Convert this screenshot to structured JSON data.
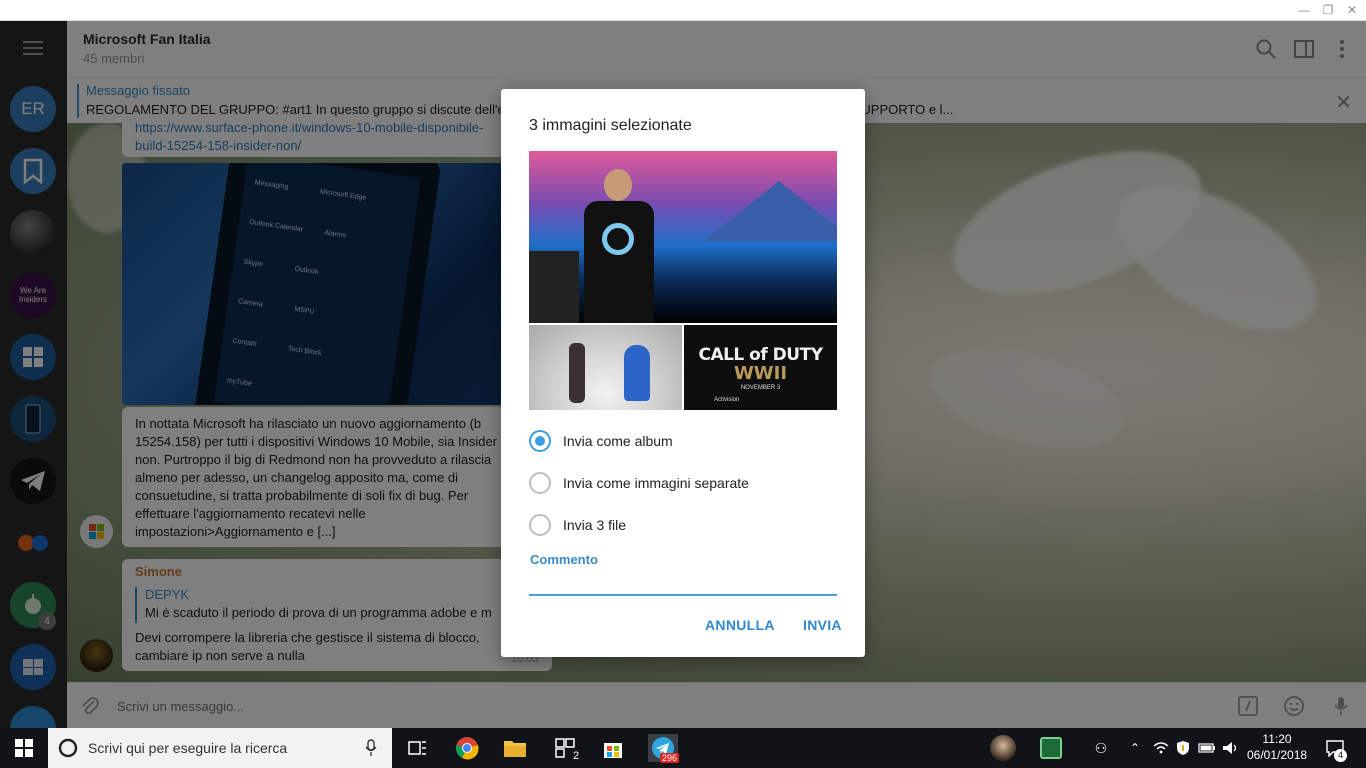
{
  "window": {
    "min_label": "—",
    "max_label": "❐",
    "close_label": "✕"
  },
  "sidebar": {
    "chats": [
      {
        "name": "account-avatar",
        "label": "ER"
      },
      {
        "name": "saved-messages",
        "label": ""
      },
      {
        "name": "chat-person",
        "label": ""
      },
      {
        "name": "chat-we-are-insiders",
        "label": "We Are Insiders"
      },
      {
        "name": "chat-windows",
        "label": ""
      },
      {
        "name": "chat-mobile",
        "label": ""
      },
      {
        "name": "chat-telegram",
        "label": ""
      },
      {
        "name": "chat-flickr",
        "label": ""
      },
      {
        "name": "chat-android",
        "label": "",
        "badge": "4"
      },
      {
        "name": "chat-windows-phone",
        "label": ""
      },
      {
        "name": "chat-telegram-2",
        "label": ""
      }
    ]
  },
  "header": {
    "title": "Microsoft Fan Italia",
    "subtitle": "45 membri"
  },
  "pinned": {
    "title": "Messaggio fissato",
    "text": "REGOLAMENTO DEL GRUPPO:  #art1 In questo gruppo si discute dell'e                                                                                      XBOX, HoloLens e Surface. Tema principale del gruppo è il SUPPORTO e l..."
  },
  "messages": {
    "link_line1": "https://www.surface-phone.it/windows-10-mobile-disponibile-",
    "link_line2": "build-15254-158-insider-non/",
    "phone_tiles": [
      "Messaging",
      "Microsoft Edge",
      "Outlook Calendar",
      "Alarms",
      "Skype",
      "Outlook",
      "Camera",
      "MSPU",
      "Contatti",
      "myTube",
      "Tech Block"
    ],
    "article_lines": [
      "In nottata Microsoft ha rilasciato un nuovo aggiornamento (b",
      "15254.158) per tutti i dispositivi Windows 10 Mobile, sia Insider",
      "non. Purtroppo il big di Redmond non ha provveduto a rilascia",
      "almeno per adesso, un changelog apposito ma, come di",
      "consuetudine, si tratta probabilmente di soli fix di bug. Per",
      "effettuare l'aggiornamento recatevi nelle",
      "impostazioni>Aggiornamento e [...]"
    ],
    "reply_author": "Simone",
    "quoted_author": "DEPYK",
    "quoted_text": "Mi è scaduto il periodo di prova di un programma adobe e m",
    "reply_lines": [
      "Devi corrompere la libreria che gestisce il sistema di blocco,",
      "cambiare ip non serve a nulla"
    ],
    "reply_time": "10:03"
  },
  "composer": {
    "placeholder": "Scrivi un messaggio..."
  },
  "dialog": {
    "title": "3 immagini selezionate",
    "poster_title": "CALL of DUTY",
    "poster_sub": "WWII",
    "poster_date": "NOVEMBER 3",
    "poster_brand": "Activision",
    "options": [
      {
        "label": "Invia come album",
        "selected": true
      },
      {
        "label": "Invia come immagini separate",
        "selected": false
      },
      {
        "label": "Invia 3 file",
        "selected": false
      }
    ],
    "comment_label": "Commento",
    "comment_value": "",
    "cancel_label": "ANNULLA",
    "send_label": "INVIA"
  },
  "taskbar": {
    "search_text": "Scrivi qui per eseguire la ricerca",
    "app_badge_1": "2",
    "telegram_badge": "296",
    "time": "11:20",
    "date": "06/01/2018",
    "notifications": "4"
  },
  "colors": {
    "accent": "#3c9de0",
    "link": "#2d7dc2",
    "taskbar": "#101418"
  }
}
